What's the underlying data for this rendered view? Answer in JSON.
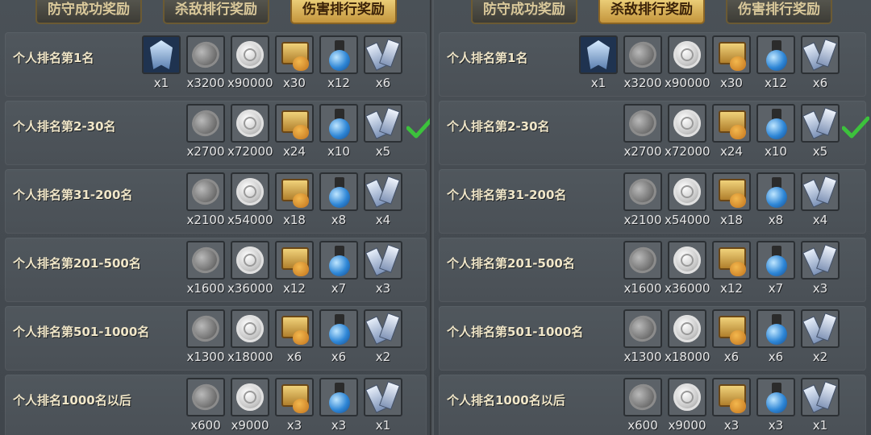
{
  "tabs": [
    {
      "label": "防守成功奖励"
    },
    {
      "label": "杀敌排行奖励"
    },
    {
      "label": "伤害排行奖励"
    }
  ],
  "left_panel": {
    "active_tab_index": 2,
    "rows": [
      {
        "label": "个人排名第1名",
        "items": [
          {
            "icon": "emblem-icon",
            "qty": "x1"
          },
          {
            "icon": "dark-coin-icon",
            "qty": "x3200"
          },
          {
            "icon": "silver-coin-icon",
            "qty": "x90000"
          },
          {
            "icon": "treasure-chest-icon",
            "qty": "x30"
          },
          {
            "icon": "blue-potion-icon",
            "qty": "x12"
          },
          {
            "icon": "crystal-icon",
            "qty": "x6"
          }
        ],
        "checked": false
      },
      {
        "label": "个人排名第2-30名",
        "items": [
          {
            "icon": "dark-coin-icon",
            "qty": "x2700"
          },
          {
            "icon": "silver-coin-icon",
            "qty": "x72000"
          },
          {
            "icon": "treasure-chest-icon",
            "qty": "x24"
          },
          {
            "icon": "blue-potion-icon",
            "qty": "x10"
          },
          {
            "icon": "crystal-icon",
            "qty": "x5"
          }
        ],
        "checked": true
      },
      {
        "label": "个人排名第31-200名",
        "items": [
          {
            "icon": "dark-coin-icon",
            "qty": "x2100"
          },
          {
            "icon": "silver-coin-icon",
            "qty": "x54000"
          },
          {
            "icon": "treasure-chest-icon",
            "qty": "x18"
          },
          {
            "icon": "blue-potion-icon",
            "qty": "x8"
          },
          {
            "icon": "crystal-icon",
            "qty": "x4"
          }
        ],
        "checked": false
      },
      {
        "label": "个人排名第201-500名",
        "items": [
          {
            "icon": "dark-coin-icon",
            "qty": "x1600"
          },
          {
            "icon": "silver-coin-icon",
            "qty": "x36000"
          },
          {
            "icon": "treasure-chest-icon",
            "qty": "x12"
          },
          {
            "icon": "blue-potion-icon",
            "qty": "x7"
          },
          {
            "icon": "crystal-icon",
            "qty": "x3"
          }
        ],
        "checked": false
      },
      {
        "label": "个人排名第501-1000名",
        "items": [
          {
            "icon": "dark-coin-icon",
            "qty": "x1300"
          },
          {
            "icon": "silver-coin-icon",
            "qty": "x18000"
          },
          {
            "icon": "treasure-chest-icon",
            "qty": "x6"
          },
          {
            "icon": "blue-potion-icon",
            "qty": "x6"
          },
          {
            "icon": "crystal-icon",
            "qty": "x2"
          }
        ],
        "checked": false
      },
      {
        "label": "个人排名1000名以后",
        "items": [
          {
            "icon": "dark-coin-icon",
            "qty": "x600"
          },
          {
            "icon": "silver-coin-icon",
            "qty": "x9000"
          },
          {
            "icon": "treasure-chest-icon",
            "qty": "x3"
          },
          {
            "icon": "blue-potion-icon",
            "qty": "x3"
          },
          {
            "icon": "crystal-icon",
            "qty": "x1"
          }
        ],
        "checked": false
      }
    ]
  },
  "right_panel": {
    "active_tab_index": 1,
    "rows": [
      {
        "label": "个人排名第1名",
        "items": [
          {
            "icon": "emblem-icon",
            "qty": "x1"
          },
          {
            "icon": "dark-coin-icon",
            "qty": "x3200"
          },
          {
            "icon": "silver-coin-icon",
            "qty": "x90000"
          },
          {
            "icon": "treasure-chest-icon",
            "qty": "x30"
          },
          {
            "icon": "blue-potion-icon",
            "qty": "x12"
          },
          {
            "icon": "crystal-icon",
            "qty": "x6"
          }
        ],
        "checked": false
      },
      {
        "label": "个人排名第2-30名",
        "items": [
          {
            "icon": "dark-coin-icon",
            "qty": "x2700"
          },
          {
            "icon": "silver-coin-icon",
            "qty": "x72000"
          },
          {
            "icon": "treasure-chest-icon",
            "qty": "x24"
          },
          {
            "icon": "blue-potion-icon",
            "qty": "x10"
          },
          {
            "icon": "crystal-icon",
            "qty": "x5"
          }
        ],
        "checked": true
      },
      {
        "label": "个人排名第31-200名",
        "items": [
          {
            "icon": "dark-coin-icon",
            "qty": "x2100"
          },
          {
            "icon": "silver-coin-icon",
            "qty": "x54000"
          },
          {
            "icon": "treasure-chest-icon",
            "qty": "x18"
          },
          {
            "icon": "blue-potion-icon",
            "qty": "x8"
          },
          {
            "icon": "crystal-icon",
            "qty": "x4"
          }
        ],
        "checked": false
      },
      {
        "label": "个人排名第201-500名",
        "items": [
          {
            "icon": "dark-coin-icon",
            "qty": "x1600"
          },
          {
            "icon": "silver-coin-icon",
            "qty": "x36000"
          },
          {
            "icon": "treasure-chest-icon",
            "qty": "x12"
          },
          {
            "icon": "blue-potion-icon",
            "qty": "x7"
          },
          {
            "icon": "crystal-icon",
            "qty": "x3"
          }
        ],
        "checked": false
      },
      {
        "label": "个人排名第501-1000名",
        "items": [
          {
            "icon": "dark-coin-icon",
            "qty": "x1300"
          },
          {
            "icon": "silver-coin-icon",
            "qty": "x18000"
          },
          {
            "icon": "treasure-chest-icon",
            "qty": "x6"
          },
          {
            "icon": "blue-potion-icon",
            "qty": "x6"
          },
          {
            "icon": "crystal-icon",
            "qty": "x2"
          }
        ],
        "checked": false
      },
      {
        "label": "个人排名1000名以后",
        "items": [
          {
            "icon": "dark-coin-icon",
            "qty": "x600"
          },
          {
            "icon": "silver-coin-icon",
            "qty": "x9000"
          },
          {
            "icon": "treasure-chest-icon",
            "qty": "x3"
          },
          {
            "icon": "blue-potion-icon",
            "qty": "x3"
          },
          {
            "icon": "crystal-icon",
            "qty": "x1"
          }
        ],
        "checked": false
      }
    ]
  },
  "colors": {
    "active_tab": "#e0b85c",
    "inactive_tab": "#4b4a44",
    "tab_text": "#d9c89a",
    "row_text": "#f0e6c8",
    "check": "#3cc23c"
  }
}
